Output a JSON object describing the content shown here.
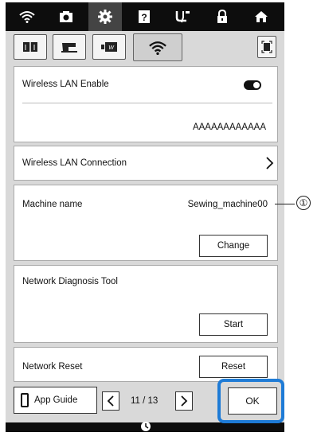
{
  "topbar": {
    "icons": [
      "wifi-icon",
      "camera-icon",
      "gear-icon",
      "help-icon",
      "needle-icon",
      "lock-icon",
      "home-icon"
    ],
    "active_index": 2
  },
  "tabs": {
    "items": [
      "book-icon",
      "sewing-machine-icon",
      "embroidery-icon",
      "wifi-icon"
    ],
    "active_index": 3,
    "right_icon": "screen-frame-icon"
  },
  "wireless_lan": {
    "label": "Wireless LAN Enable",
    "enabled": true,
    "ssid": "AAAAAAAAAAAA"
  },
  "connection": {
    "label": "Wireless LAN Connection"
  },
  "machine": {
    "label": "Machine name",
    "value": "Sewing_machine00",
    "button": "Change"
  },
  "diagnosis": {
    "label": "Network Diagnosis Tool",
    "button": "Start"
  },
  "reset": {
    "label": "Network Reset",
    "button": "Reset"
  },
  "footer": {
    "app_guide": "App Guide",
    "page": "11 / 13",
    "ok": "OK"
  },
  "callout": {
    "number": "①"
  },
  "colors": {
    "highlight": "#1e7bd6",
    "topbar": "#0d0d0d",
    "background": "#d9d9d9"
  }
}
